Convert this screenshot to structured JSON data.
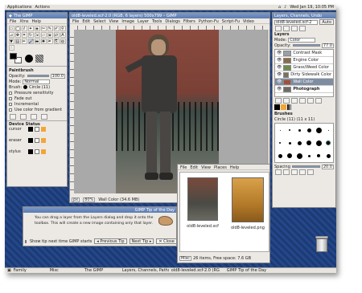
{
  "top_panel": {
    "menus": [
      "Applications",
      "Actions"
    ],
    "clock": "Wed Jan 19, 10:05 PM"
  },
  "toolbox": {
    "title": "The GIMP",
    "menus": [
      "File",
      "Xtns",
      "Help"
    ],
    "paintbrush": {
      "title": "Paintbrush",
      "opacity_label": "Opacity:",
      "opacity_value": "100.0",
      "mode_label": "Mode:",
      "mode_value": "Normal",
      "brush_label": "Brush:",
      "brush_value": "Circle (11)",
      "options": [
        "Pressure sensitivity",
        "Fade out",
        "Incremental",
        "Use color from gradient"
      ]
    },
    "device_status": {
      "title": "Device Status",
      "devices": [
        "cursor",
        "eraser",
        "stylus"
      ]
    }
  },
  "image_window": {
    "title": "old8-leveled.xcf-2.0 (RGB, 6 layers) 500x799 – GIMP",
    "menus": [
      "File",
      "Edit",
      "Select",
      "View",
      "Image",
      "Layer",
      "Tools",
      "Dialogs",
      "Filters",
      "Python-Fu",
      "Script-Fu",
      "Video"
    ],
    "unit": "px",
    "zoom": "80%",
    "status": "Wall Color (34.6 MB)"
  },
  "layers": {
    "window_title": "Layers, Channels, Undo",
    "image_select": "old8-leveled.xcf-2",
    "auto_button": "Auto",
    "panel_title": "Layers",
    "mode_label": "Mode:",
    "mode_value": "Color",
    "opacity_label": "Opacity:",
    "opacity_value": "77.0",
    "items": [
      {
        "name": "Contrast Mask",
        "bold": false,
        "selected": false,
        "color": "#9aa0a8"
      },
      {
        "name": "Engine Color",
        "bold": false,
        "selected": false,
        "color": "#8c6a44"
      },
      {
        "name": "Grass/Weed Color",
        "bold": false,
        "selected": false,
        "color": "#6d8c4a"
      },
      {
        "name": "Dirty Sidewalk Color",
        "bold": false,
        "selected": false,
        "color": "#7a7060"
      },
      {
        "name": "Wall Color",
        "bold": false,
        "selected": true,
        "color": "#a0503c"
      },
      {
        "name": "Photograph",
        "bold": true,
        "selected": false,
        "color": "#6e6a64"
      }
    ],
    "brushes_title": "Brushes",
    "brush_info": "Circle (11) (11 x 11)",
    "spacing_label": "Spacing",
    "spacing_value": "20.0"
  },
  "browser": {
    "menus": [
      "File",
      "Edit",
      "View",
      "Places",
      "Help"
    ],
    "files": [
      {
        "name": "old8-leveled.xcf"
      },
      {
        "name": "old8-leveled.png"
      }
    ],
    "statusbar": "26 items, Free space: 7.6 GB",
    "location_label": "Misc"
  },
  "tip": {
    "title": "GIMP Tip of the Day",
    "text": "You can drag a layer from the Layers dialog and drop it onto the toolbox. This will create a new image containing only that layer.",
    "show_label": "Show tip next time GIMP starts",
    "prev_button": "Previous Tip",
    "next_button": "Next Tip",
    "close_button": "Close"
  },
  "taskbar": {
    "items": [
      "Family",
      "Misc",
      "The GIMP",
      "Layers, Channels, Paths...",
      "old8-leveled.xcf-2.0 (RG",
      "GIMP Tip of the Day"
    ]
  }
}
